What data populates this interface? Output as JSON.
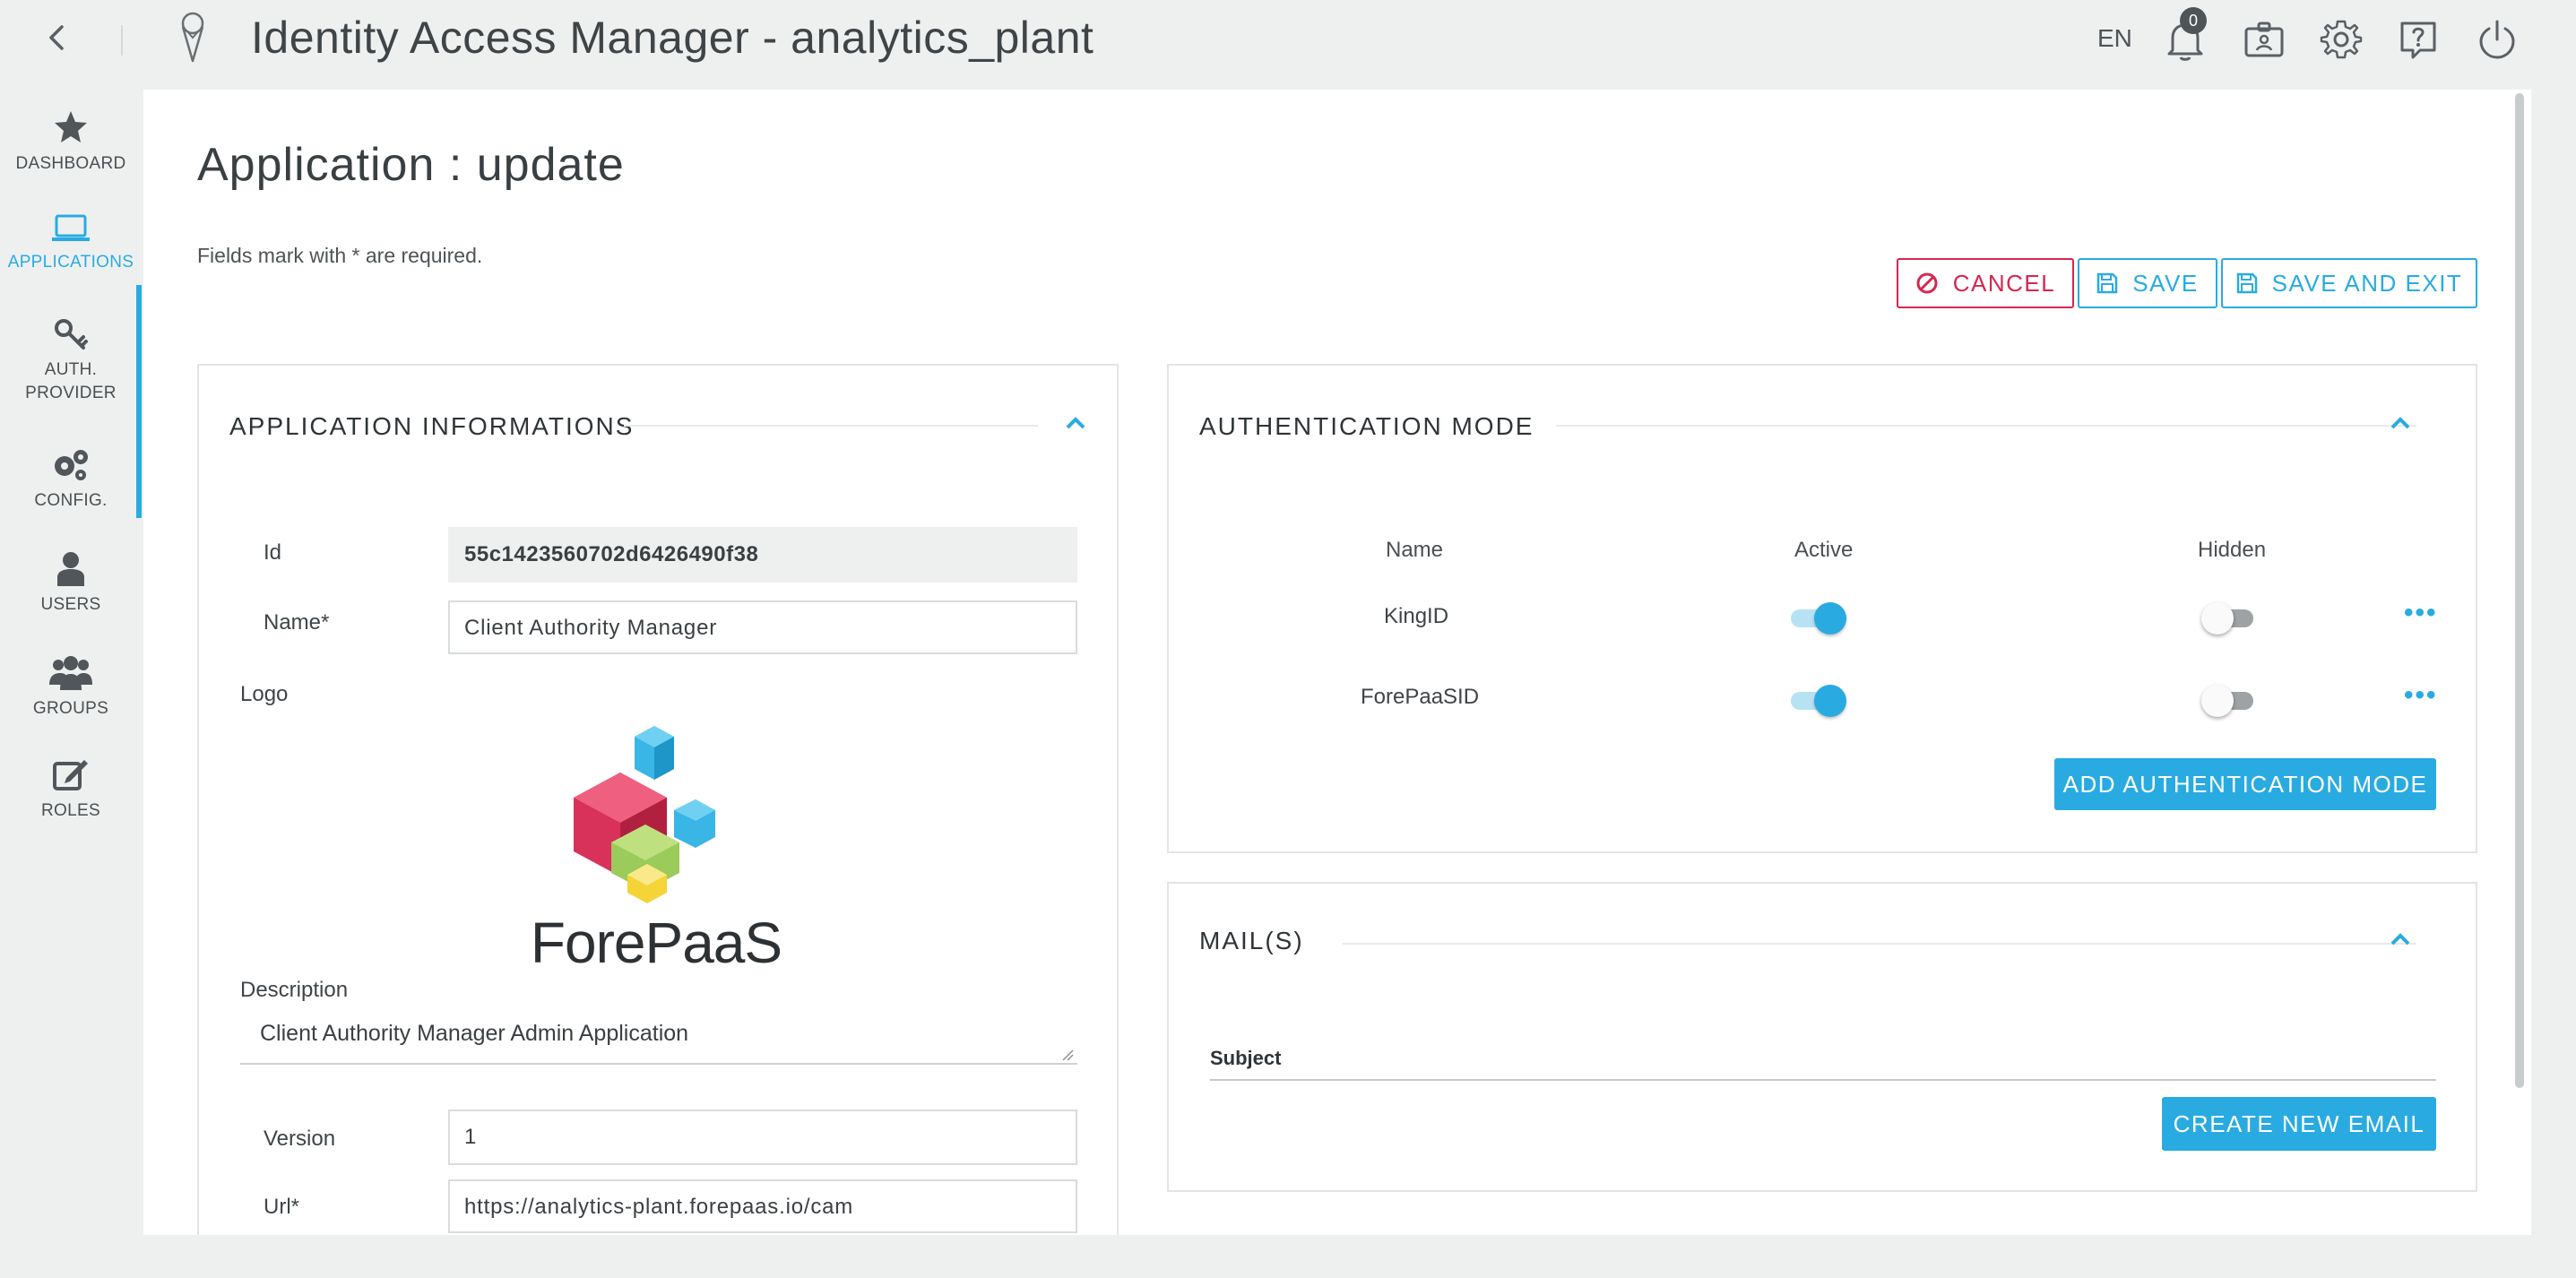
{
  "topbar": {
    "title": "Identity Access Manager - analytics_plant",
    "language": "EN",
    "notification_count": "0",
    "icons": [
      "back-icon",
      "app-logo-icon",
      "bell-icon",
      "id-card-icon",
      "gear-icon",
      "help-icon",
      "power-icon"
    ]
  },
  "sidebar": {
    "items": [
      {
        "label": "DASHBOARD",
        "icon": "star-icon"
      },
      {
        "label": "APPLICATIONS",
        "icon": "laptop-icon"
      },
      {
        "label": "AUTH.",
        "label2": "PROVIDER",
        "icon": "key-icon"
      },
      {
        "label": "CONFIG.",
        "icon": "gears-icon"
      },
      {
        "label": "USERS",
        "icon": "user-icon"
      },
      {
        "label": "GROUPS",
        "icon": "group-icon"
      },
      {
        "label": "ROLES",
        "icon": "edit-icon"
      }
    ],
    "active": "APPLICATIONS",
    "accent": "#29abe2"
  },
  "page": {
    "title": "Application : update",
    "required_note": "Fields mark with * are required."
  },
  "actions": {
    "cancel": "CANCEL",
    "save": "SAVE",
    "save_exit": "SAVE AND EXIT",
    "cancel_color": "#d7264f"
  },
  "app_info": {
    "title": "APPLICATION INFORMATIONS",
    "id_label": "Id",
    "id_value": "55c1423560702d6426490f38",
    "name_label": "Name*",
    "name_value": "Client Authority Manager",
    "logo_label": "Logo",
    "logo_text": "ForePaaS",
    "description_label": "Description",
    "description_value": "Client Authority Manager Admin Application",
    "version_label": "Version",
    "version_value": "1",
    "url_label": "Url*",
    "url_value": "https://analytics-plant.forepaas.io/cam"
  },
  "auth_mode": {
    "title": "AUTHENTICATION MODE",
    "columns": [
      "Name",
      "Active",
      "Hidden"
    ],
    "rows": [
      {
        "name": "KingID",
        "active": true,
        "hidden": false
      },
      {
        "name": "ForePaaSID",
        "active": true,
        "hidden": false
      }
    ],
    "more": "•••",
    "add_button": "ADD AUTHENTICATION MODE"
  },
  "mails": {
    "title": "MAIL(S)",
    "subject_header": "Subject",
    "create_button": "CREATE NEW EMAIL"
  }
}
